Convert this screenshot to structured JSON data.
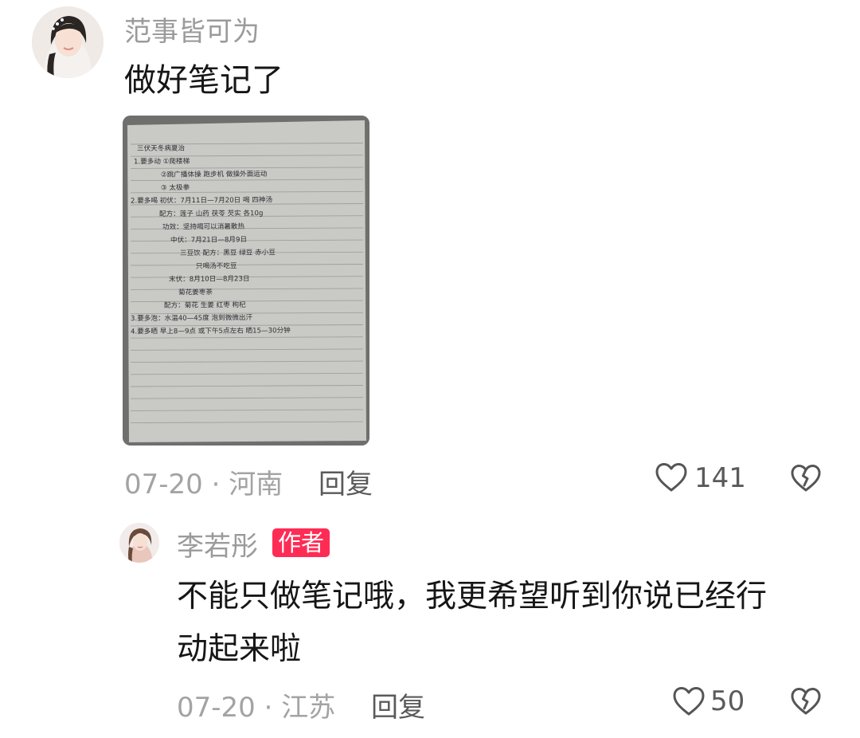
{
  "comments": [
    {
      "username": "范事皆可为",
      "text": "做好笔记了",
      "date": "07-20",
      "separator": "·",
      "location": "河南",
      "reply_label": "回复",
      "likes": "141",
      "image": {
        "notes": {
          "lines": [
            "三伏天冬病夏治",
            "1.要多动 ①爬楼梯",
            "②跳广播体操 跑步机 做操外面运动",
            "③ 太极拳",
            "2.要多喝 初伏：7月11日—7月20日 喝 四神汤",
            "配方：莲子 山药 茯苓 芡实 各10g",
            "功效：坚持喝可以消暑散热",
            "中伏：7月21日—8月9日",
            "三豆饮 配方：黑豆 绿豆 赤小豆",
            "只喝汤不吃豆",
            "末伏：8月10日—8月23日",
            "菊花姜枣茶",
            "配方：菊花 生姜 红枣 枸杞",
            "3.要多泡：水温40—45度 泡到微微出汗",
            "4.要多晒 早上8—9点 或下午5点左右 晒15—30分钟"
          ]
        }
      }
    },
    {
      "username": "李若彤",
      "badge": "作者",
      "text_line1": "不能只做笔记哦，我更希望听到你说已经行",
      "text_line2": "动起来啦",
      "date": "07-20",
      "separator": "·",
      "location": "江苏",
      "reply_label": "回复",
      "likes": "50"
    }
  ],
  "icons": {
    "like": "heart-outline-icon",
    "dislike": "broken-heart-icon"
  },
  "colors": {
    "badge": "#fe2c55",
    "username": "#9b9b9b",
    "meta": "#a3a3a3"
  }
}
